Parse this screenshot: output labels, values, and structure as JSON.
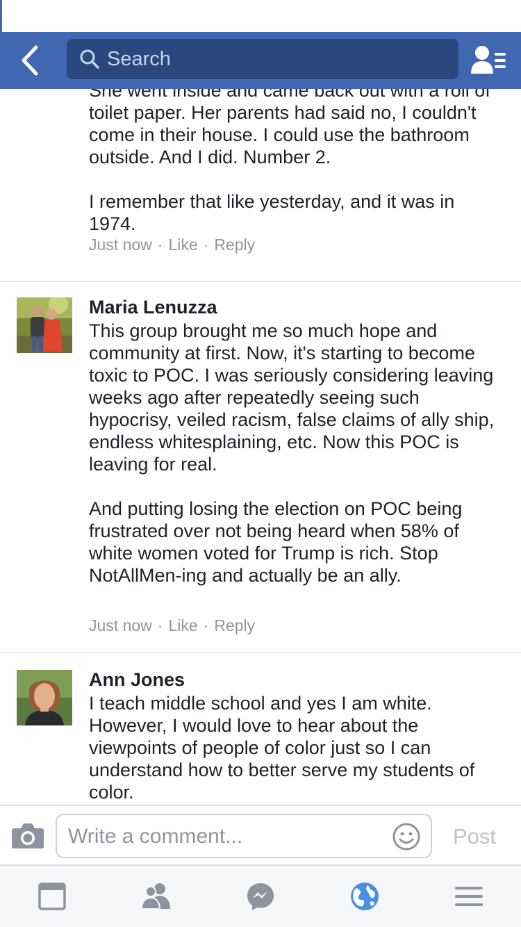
{
  "header": {
    "search_placeholder": "Search"
  },
  "comments": [
    {
      "body": "She went inside and came back out with a roll of toilet paper. Her parents had said no, I couldn't come in their house. I could use the bathroom outside. And I did. Number 2.\n\nI remember that like yesterday, and it was in 1974.",
      "time": "Just now",
      "like": "Like",
      "reply": "Reply"
    },
    {
      "name": "Maria Lenuzza",
      "body": "This group brought me so much hope and community at first. Now, it's starting to become toxic to POC. I was seriously considering leaving weeks ago after repeatedly seeing such hypocrisy, veiled racism, false claims of ally ship, endless whitesplaining, etc. Now this POC is leaving for real.\n\nAnd putting losing the election on POC being frustrated over not being heard when 58% of white women voted for Trump is rich. Stop NotAllMen-ing and actually be an ally.",
      "time": "Just now",
      "like": "Like",
      "reply": "Reply"
    },
    {
      "name": "Ann Jones",
      "body": "I teach middle school and yes I am white. However, I would love to hear about the viewpoints of people of color just so I can understand how to better serve my students of color."
    }
  ],
  "composer": {
    "placeholder": "Write a comment...",
    "post_label": "Post"
  },
  "tabs": [
    "news-feed-icon",
    "friends-icon",
    "messenger-icon",
    "notifications-globe-icon",
    "menu-icon"
  ],
  "colors": {
    "brand": "#4267b2",
    "search_bg": "#29487d",
    "meta_gray": "#90949c",
    "active_tab": "#4a90e2"
  }
}
